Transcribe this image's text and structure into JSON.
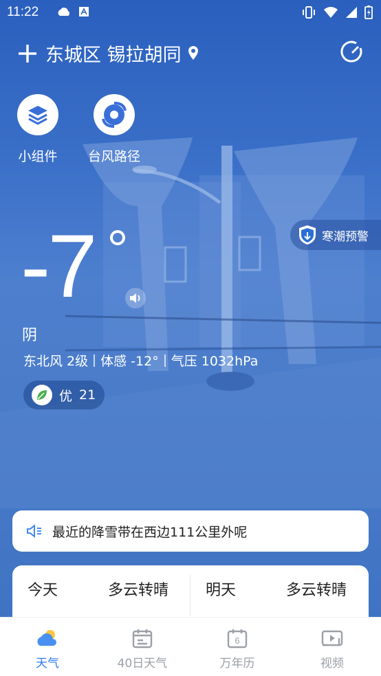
{
  "status_bar": {
    "time": "11:22"
  },
  "header": {
    "location": "东城区 锡拉胡同"
  },
  "quick_actions": [
    {
      "label": "小组件",
      "icon": "layers-icon"
    },
    {
      "label": "台风路径",
      "icon": "typhoon-icon"
    }
  ],
  "alert": {
    "label": "寒潮预警"
  },
  "current": {
    "temperature": "-7",
    "condition": "阴",
    "wind": "东北风 2级",
    "feels_like": "体感 -12°",
    "pressure": "气压 1032hPa",
    "aqi_label": "优",
    "aqi_value": "21"
  },
  "notice": {
    "text": "最近的降雪带在西边111公里外呢"
  },
  "forecast": [
    {
      "day": "今天",
      "condition": "多云转晴"
    },
    {
      "day": "明天",
      "condition": "多云转晴"
    }
  ],
  "tabs": [
    {
      "label": "天气",
      "icon": "weather-icon",
      "active": true
    },
    {
      "label": "40日天气",
      "icon": "calendar-40-icon",
      "active": false
    },
    {
      "label": "万年历",
      "icon": "calendar-icon",
      "active": false,
      "icon_text": "6"
    },
    {
      "label": "视频",
      "icon": "video-icon",
      "active": false
    }
  ],
  "colors": {
    "accent": "#2e7cf6",
    "sky_top": "#2a5fbe",
    "sky_bottom": "#3f74c3",
    "alert_icon": "#2a6fd6",
    "aqi_leaf": "#4caf50"
  }
}
